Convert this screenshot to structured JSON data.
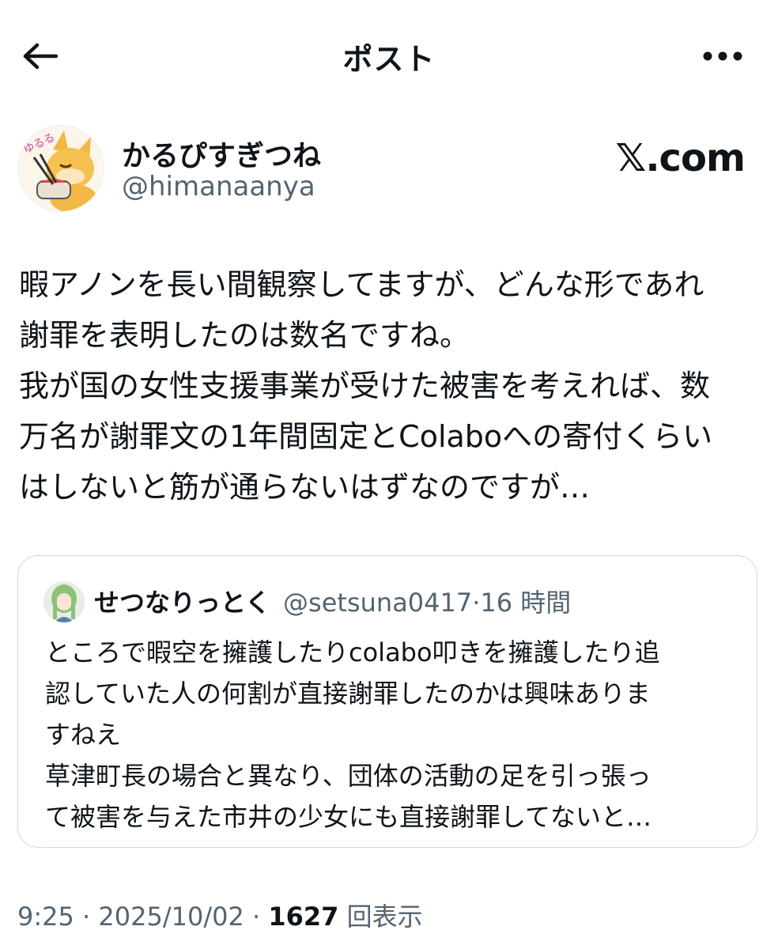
{
  "header": {
    "title": "ポスト",
    "back_icon": "arrow-left-icon",
    "more_icon": "more-horizontal-icon"
  },
  "author": {
    "display_name": "かるぴすぎつね",
    "handle": "@himanaanya",
    "source": "𝕏.com",
    "avatar_badge": "ゆるる"
  },
  "body": {
    "lines": [
      "暇アノンを長い間観察してますが、どんな形であれ",
      "謝罪を表明したのは数名ですね。",
      "我が国の女性支援事業が受けた被害を考えれば、数",
      "万名が謝罪文の1年間固定とColaboへの寄付くらい",
      "はしないと筋が通らないはずなのですが…"
    ]
  },
  "quote": {
    "display_name": "せつなりっとく",
    "handle": "@setsuna0417",
    "separator": "·",
    "time": "16 時間",
    "lines": [
      "ところで暇空を擁護したりcolabo叩きを擁護したり追",
      "認していた人の何割が直接謝罪したのかは興味ありま",
      "すねえ",
      "草津町長の場合と異なり、団体の活動の足を引っ張っ",
      "て被害を与えた市井の少女にも直接謝罪してないと…"
    ]
  },
  "meta": {
    "time": "9:25",
    "sep1": " · ",
    "date": "2025/10/02",
    "sep2": " · ",
    "views_count": "1627",
    "views_label": " 回表示"
  },
  "colors": {
    "text": "#0f1419",
    "secondary": "#536471",
    "border": "#cfd9de"
  }
}
